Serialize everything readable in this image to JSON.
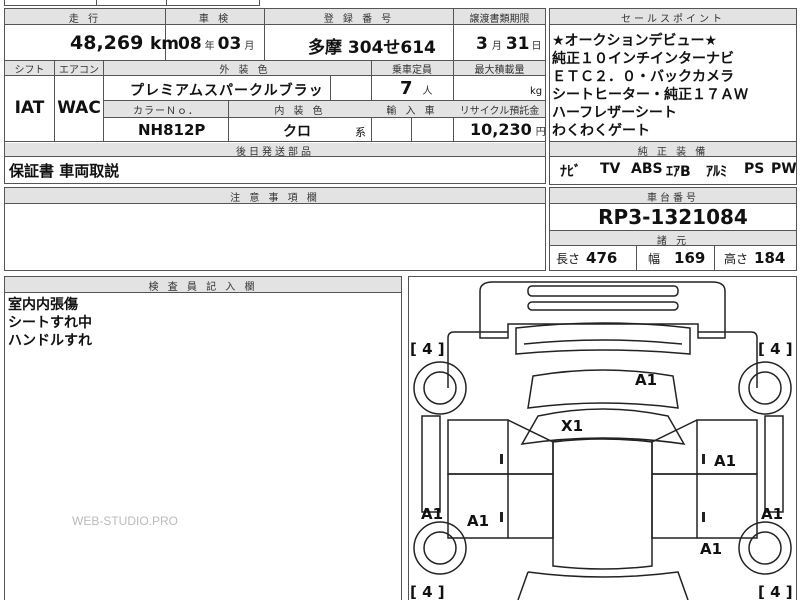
{
  "headers": {
    "mileage": "走 行",
    "inspection": "車 検",
    "registration": "登 録 番 号",
    "transfer_deadline": "譲渡書類期限",
    "sales_point": "セールスポイント",
    "shift": "シフト",
    "aircon": "エアコン",
    "exterior_color": "外 装 色",
    "capacity": "乗車定員",
    "max_load": "最大積載量",
    "color_no": "カラーＮｏ．",
    "interior_color": "内 装 色",
    "import": "輸 入 車",
    "recycle": "リサイクル預託金",
    "accessories": "後日発送部品",
    "equipment": "純 正 装 備",
    "caution": "注 意 事 項 欄",
    "chassis": "車台番号",
    "specs": "諸 元",
    "inspector": "検 査 員 記 入 欄"
  },
  "values": {
    "mileage_value": "48,269",
    "mileage_unit": "km",
    "inspection_year": "08",
    "year_unit": "年",
    "inspection_month": "03",
    "month_unit": "月",
    "registration": "多摩 304せ614",
    "transfer_month": "3",
    "transfer_month_unit": "月",
    "transfer_day": "31",
    "day_unit": "日",
    "shift": "IAT",
    "aircon": "WAC",
    "exterior_color": "プレミアムスパークルブラッ",
    "capacity": "7",
    "capacity_unit": "人",
    "load_unit": "kg",
    "color_no": "NH812P",
    "interior_color": "クロ",
    "interior_suffix": "系",
    "recycle": "10,230",
    "recycle_unit": "円",
    "accessories": "保証書 車両取説",
    "chassis": "RP3-1321084"
  },
  "sales_points": [
    "★オークションデビュー★",
    "純正１０インチインターナビ",
    "ＥＴＣ２．０・バックカメラ",
    "シートヒーター・純正１７ＡＷ",
    "ハーフレザーシート",
    "わくわくゲート"
  ],
  "equipment": [
    "ﾅﾋﾞ",
    "TV",
    "ABS",
    "ｴｱB",
    "ｱﾙﾐ",
    "PS",
    "PW"
  ],
  "specs": {
    "length_label": "長さ",
    "length": "476",
    "width_label": "幅",
    "width": "169",
    "height_label": "高さ",
    "height": "184"
  },
  "inspector_notes": [
    "室内内張傷",
    "シートすれ中",
    "ハンドルすれ"
  ],
  "diagram": {
    "tire_tl": "[ 4 ]",
    "tire_tr": "[ 4 ]",
    "tire_bl": "[ 4 ]",
    "tire_br": "[ 4 ]",
    "code_bonnet": "A1",
    "code_windshield": "X1",
    "code_right_front_door": "A1",
    "code_left_front_door": "A1",
    "code_left_edge": "A1",
    "code_right_edge": "A1",
    "code_right_rear_door": "A1"
  },
  "watermark": "WEB-STUDIO.PRO",
  "colors": {
    "header_bg": "#e3e3e3",
    "border": "#555555",
    "text": "#111111"
  }
}
